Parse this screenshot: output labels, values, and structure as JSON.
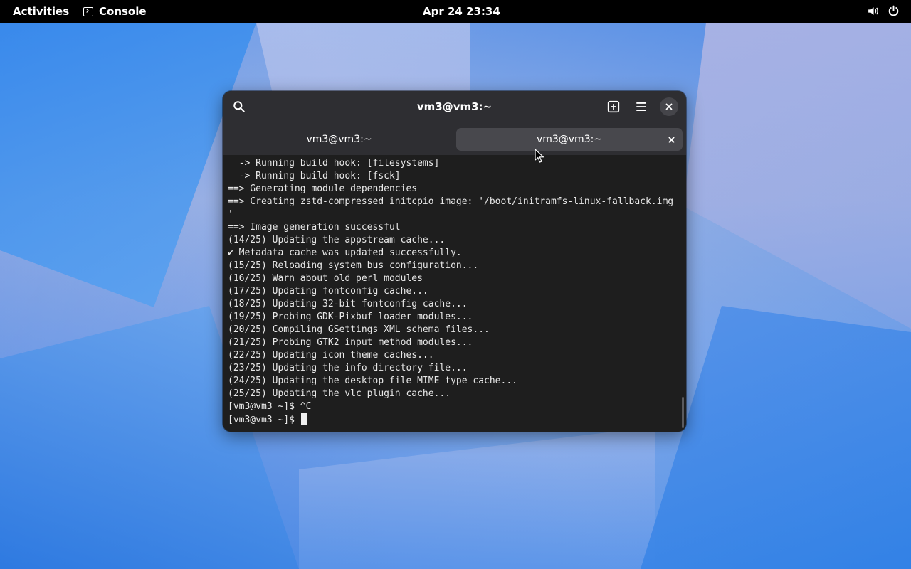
{
  "topbar": {
    "activities": "Activities",
    "app_name": "Console",
    "clock": "Apr 24  23:34",
    "icons": [
      "volume-icon",
      "power-icon"
    ]
  },
  "window": {
    "title": "vm3@vm3:~",
    "tabs": [
      {
        "label": "vm3@vm3:~",
        "active": false
      },
      {
        "label": "vm3@vm3:~",
        "active": true
      }
    ]
  },
  "terminal": {
    "lines": [
      "  -> Running build hook: [filesystems]",
      "  -> Running build hook: [fsck]",
      "==> Generating module dependencies",
      "==> Creating zstd-compressed initcpio image: '/boot/initramfs-linux-fallback.img",
      "'",
      "==> Image generation successful",
      "(14/25) Updating the appstream cache...",
      "✔ Metadata cache was updated successfully.",
      "(15/25) Reloading system bus configuration...",
      "(16/25) Warn about old perl modules",
      "(17/25) Updating fontconfig cache...",
      "(18/25) Updating 32-bit fontconfig cache...",
      "(19/25) Probing GDK-Pixbuf loader modules...",
      "(20/25) Compiling GSettings XML schema files...",
      "(21/25) Probing GTK2 input method modules...",
      "(22/25) Updating icon theme caches...",
      "(23/25) Updating the info directory file...",
      "(24/25) Updating the desktop file MIME type cache...",
      "(25/25) Updating the vlc plugin cache...",
      "[vm3@vm3 ~]$ ^C"
    ],
    "prompt": "[vm3@vm3 ~]$ "
  },
  "colors": {
    "topbar_bg": "#000000",
    "window_bg": "#1e1e1e",
    "headerbar_bg": "#2e2e32",
    "active_tab_bg": "#48484d",
    "text": "#e8e8e8"
  }
}
